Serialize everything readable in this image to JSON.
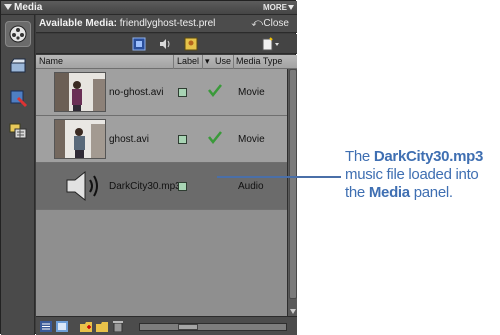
{
  "panel": {
    "title": "Media",
    "more_label": "MORE"
  },
  "header": {
    "available_label": "Available Media:",
    "project_name": "friendlyghost-test.prel",
    "close_label": "Close"
  },
  "columns": {
    "name": "Name",
    "label": "Label",
    "used": "Use",
    "media_type": "Media Type"
  },
  "items": [
    {
      "name": "no-ghost.avi",
      "used": true,
      "media_type": "Movie",
      "thumb": "video-thumbnail"
    },
    {
      "name": "ghost.avi",
      "used": true,
      "media_type": "Movie",
      "thumb": "video-thumbnail"
    },
    {
      "name": "DarkCity30.mp3",
      "used": false,
      "media_type": "Audio",
      "thumb": "speaker-icon",
      "selected": true
    }
  ],
  "callout": {
    "line1_prefix": "The ",
    "line1_bold": "DarkCity30.mp3",
    "line2": "music file loaded into",
    "line3_prefix": "the ",
    "line3_bold": "Media",
    "line3_suffix": " panel."
  },
  "colors": {
    "callout": "#3f6fb2",
    "label_swatch": "#a8d4b4",
    "check": "#3a9a3a"
  }
}
